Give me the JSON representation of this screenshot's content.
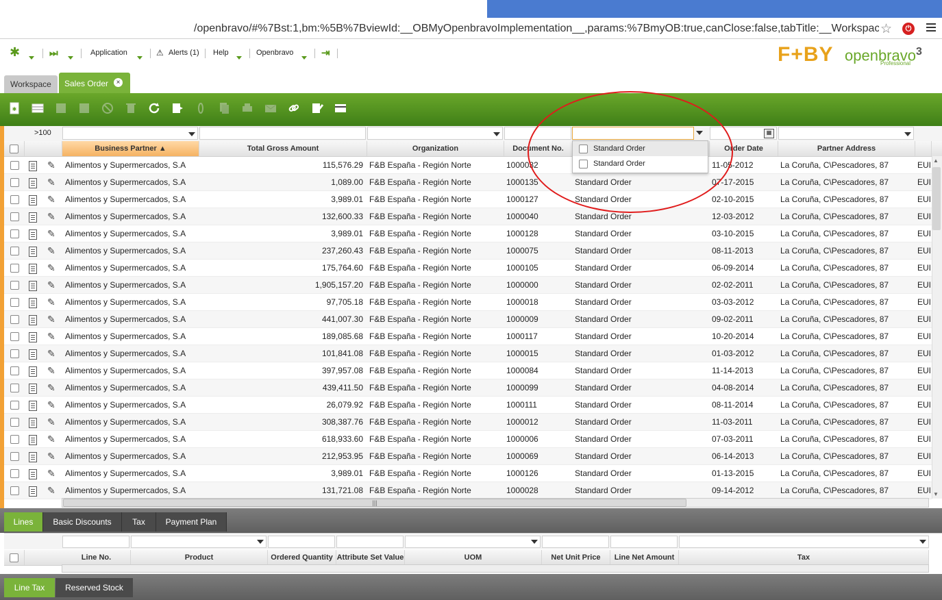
{
  "browser": {
    "url": "/openbravo/#%7Bst:1,bm:%5B%7BviewId:__OBMyOpenbravoImplementation__,params:%7BmyOB:true,canClose:false,tabTitle:__Workspace"
  },
  "nav": {
    "application": "Application",
    "alerts": "Alerts (1)",
    "help": "Help",
    "openbravo": "Openbravo"
  },
  "branding": {
    "fbl": "F+BY",
    "openbravo": "openbravo",
    "version": "3",
    "edition": "Professional"
  },
  "tabs": {
    "workspace": "Workspace",
    "sales_order": "Sales Order",
    "close": "×"
  },
  "grid": {
    "row_count": ">100",
    "columns": {
      "business_partner": "Business Partner",
      "total_gross": "Total Gross Amount",
      "organization": "Organization",
      "document_no": "Document No.",
      "order_date": "Order Date",
      "partner_address": "Partner Address"
    },
    "sort_indicator": "▲",
    "rows": [
      {
        "bp": "Alimentos y Supermercados, S.A",
        "amt": "115,576.29",
        "org": "F&B España - Región Norte",
        "doc": "1000032",
        "type": "",
        "date": "11-05-2012",
        "addr": "La Coruña, C\\Pescadores, 87",
        "cur": "EUI"
      },
      {
        "bp": "Alimentos y Supermercados, S.A",
        "amt": "1,089.00",
        "org": "F&B España - Región Norte",
        "doc": "1000135",
        "type": "Standard Order",
        "date": "07-17-2015",
        "addr": "La Coruña, C\\Pescadores, 87",
        "cur": "EUI"
      },
      {
        "bp": "Alimentos y Supermercados, S.A",
        "amt": "3,989.01",
        "org": "F&B España - Región Norte",
        "doc": "1000127",
        "type": "Standard Order",
        "date": "02-10-2015",
        "addr": "La Coruña, C\\Pescadores, 87",
        "cur": "EUI"
      },
      {
        "bp": "Alimentos y Supermercados, S.A",
        "amt": "132,600.33",
        "org": "F&B España - Región Norte",
        "doc": "1000040",
        "type": "Standard Order",
        "date": "12-03-2012",
        "addr": "La Coruña, C\\Pescadores, 87",
        "cur": "EUI"
      },
      {
        "bp": "Alimentos y Supermercados, S.A",
        "amt": "3,989.01",
        "org": "F&B España - Región Norte",
        "doc": "1000128",
        "type": "Standard Order",
        "date": "03-10-2015",
        "addr": "La Coruña, C\\Pescadores, 87",
        "cur": "EUI"
      },
      {
        "bp": "Alimentos y Supermercados, S.A",
        "amt": "237,260.43",
        "org": "F&B España - Región Norte",
        "doc": "1000075",
        "type": "Standard Order",
        "date": "08-11-2013",
        "addr": "La Coruña, C\\Pescadores, 87",
        "cur": "EUI"
      },
      {
        "bp": "Alimentos y Supermercados, S.A",
        "amt": "175,764.60",
        "org": "F&B España - Región Norte",
        "doc": "1000105",
        "type": "Standard Order",
        "date": "06-09-2014",
        "addr": "La Coruña, C\\Pescadores, 87",
        "cur": "EUI"
      },
      {
        "bp": "Alimentos y Supermercados, S.A",
        "amt": "1,905,157.20",
        "org": "F&B España - Región Norte",
        "doc": "1000000",
        "type": "Standard Order",
        "date": "02-02-2011",
        "addr": "La Coruña, C\\Pescadores, 87",
        "cur": "EUI"
      },
      {
        "bp": "Alimentos y Supermercados, S.A",
        "amt": "97,705.18",
        "org": "F&B España - Región Norte",
        "doc": "1000018",
        "type": "Standard Order",
        "date": "03-03-2012",
        "addr": "La Coruña, C\\Pescadores, 87",
        "cur": "EUI"
      },
      {
        "bp": "Alimentos y Supermercados, S.A",
        "amt": "441,007.30",
        "org": "F&B España - Región Norte",
        "doc": "1000009",
        "type": "Standard Order",
        "date": "09-02-2011",
        "addr": "La Coruña, C\\Pescadores, 87",
        "cur": "EUI"
      },
      {
        "bp": "Alimentos y Supermercados, S.A",
        "amt": "189,085.68",
        "org": "F&B España - Región Norte",
        "doc": "1000117",
        "type": "Standard Order",
        "date": "10-20-2014",
        "addr": "La Coruña, C\\Pescadores, 87",
        "cur": "EUI"
      },
      {
        "bp": "Alimentos y Supermercados, S.A",
        "amt": "101,841.08",
        "org": "F&B España - Región Norte",
        "doc": "1000015",
        "type": "Standard Order",
        "date": "01-03-2012",
        "addr": "La Coruña, C\\Pescadores, 87",
        "cur": "EUI"
      },
      {
        "bp": "Alimentos y Supermercados, S.A",
        "amt": "397,957.08",
        "org": "F&B España - Región Norte",
        "doc": "1000084",
        "type": "Standard Order",
        "date": "11-14-2013",
        "addr": "La Coruña, C\\Pescadores, 87",
        "cur": "EUI"
      },
      {
        "bp": "Alimentos y Supermercados, S.A",
        "amt": "439,411.50",
        "org": "F&B España - Región Norte",
        "doc": "1000099",
        "type": "Standard Order",
        "date": "04-08-2014",
        "addr": "La Coruña, C\\Pescadores, 87",
        "cur": "EUI"
      },
      {
        "bp": "Alimentos y Supermercados, S.A",
        "amt": "26,079.92",
        "org": "F&B España - Región Norte",
        "doc": "1000111",
        "type": "Standard Order",
        "date": "08-11-2014",
        "addr": "La Coruña, C\\Pescadores, 87",
        "cur": "EUI"
      },
      {
        "bp": "Alimentos y Supermercados, S.A",
        "amt": "308,387.76",
        "org": "F&B España - Región Norte",
        "doc": "1000012",
        "type": "Standard Order",
        "date": "11-03-2011",
        "addr": "La Coruña, C\\Pescadores, 87",
        "cur": "EUI"
      },
      {
        "bp": "Alimentos y Supermercados, S.A",
        "amt": "618,933.60",
        "org": "F&B España - Región Norte",
        "doc": "1000006",
        "type": "Standard Order",
        "date": "07-03-2011",
        "addr": "La Coruña, C\\Pescadores, 87",
        "cur": "EUI"
      },
      {
        "bp": "Alimentos y Supermercados, S.A",
        "amt": "212,953.95",
        "org": "F&B España - Región Norte",
        "doc": "1000069",
        "type": "Standard Order",
        "date": "06-14-2013",
        "addr": "La Coruña, C\\Pescadores, 87",
        "cur": "EUI"
      },
      {
        "bp": "Alimentos y Supermercados, S.A",
        "amt": "3,989.01",
        "org": "F&B España - Región Norte",
        "doc": "1000126",
        "type": "Standard Order",
        "date": "01-13-2015",
        "addr": "La Coruña, C\\Pescadores, 87",
        "cur": "EUI"
      },
      {
        "bp": "Alimentos y Supermercados, S.A",
        "amt": "131,721.08",
        "org": "F&B España - Región Norte",
        "doc": "1000028",
        "type": "Standard Order",
        "date": "09-14-2012",
        "addr": "La Coruña, C\\Pescadores, 87",
        "cur": "EUI"
      }
    ]
  },
  "dropdown": {
    "options": [
      "Standard Order",
      "Standard Order"
    ]
  },
  "subtabs": [
    "Lines",
    "Basic Discounts",
    "Tax",
    "Payment Plan"
  ],
  "lines_grid": {
    "columns": {
      "line_no": "Line No.",
      "product": "Product",
      "ordered_qty": "Ordered Quantity",
      "attribute_set": "Attribute Set Value",
      "uom": "UOM",
      "net_unit_price": "Net Unit Price",
      "line_net_amount": "Line Net Amount",
      "tax": "Tax"
    }
  },
  "subtabs2": [
    "Line Tax",
    "Reserved Stock"
  ],
  "colors": {
    "brand_green": "#5a9a1c",
    "highlight_orange": "#f2a135",
    "annotation_red": "#e01b1b"
  }
}
